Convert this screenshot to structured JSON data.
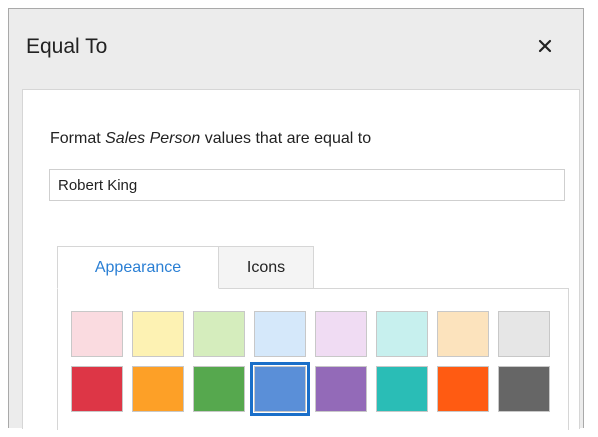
{
  "dialog": {
    "title": "Equal To",
    "close_label": "×"
  },
  "form": {
    "prompt_prefix": "Format",
    "prompt_field": "Sales Person",
    "prompt_suffix": "values that are equal to",
    "value": "Robert King"
  },
  "tabs": [
    {
      "label": "Appearance",
      "active": true
    },
    {
      "label": "Icons",
      "active": false
    }
  ],
  "swatches": {
    "row1": [
      "#fadbe0",
      "#fdf2b3",
      "#d5edbd",
      "#d5e8fa",
      "#f0dcf3",
      "#c7f0ee",
      "#fce3bd",
      "#e6e6e6"
    ],
    "row2": [
      "#dd3646",
      "#fda027",
      "#56a84e",
      "#5a8fd8",
      "#936ab8",
      "#2abdb6",
      "#ff5b12",
      "#666666"
    ],
    "selected_row": 1,
    "selected_index": 3
  },
  "colors": {
    "accent": "#2a7fd4",
    "selection_border": "#1a6fc9"
  }
}
